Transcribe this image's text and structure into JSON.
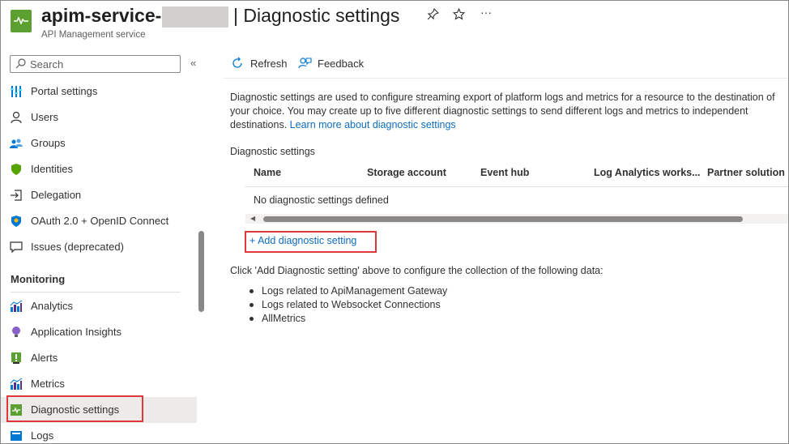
{
  "header": {
    "resource_name": "apim-service-",
    "page_title": "| Diagnostic settings",
    "subtitle": "API Management service",
    "pin_icon": "pin-icon",
    "star_icon": "star-icon",
    "more_label": "···"
  },
  "sidebar": {
    "search_placeholder": "Search",
    "collapse_label": "«",
    "items": [
      {
        "label": "Portal settings",
        "icon": "portal-settings-icon"
      },
      {
        "label": "Users",
        "icon": "user-icon"
      },
      {
        "label": "Groups",
        "icon": "groups-icon"
      },
      {
        "label": "Identities",
        "icon": "shield-icon"
      },
      {
        "label": "Delegation",
        "icon": "delegation-icon"
      },
      {
        "label": "OAuth 2.0 + OpenID Connect",
        "icon": "oauth-shield-icon"
      },
      {
        "label": "Issues (deprecated)",
        "icon": "chat-icon"
      }
    ],
    "monitoring_heading": "Monitoring",
    "monitoring_items": [
      {
        "label": "Analytics",
        "icon": "analytics-icon"
      },
      {
        "label": "Application Insights",
        "icon": "lightbulb-icon"
      },
      {
        "label": "Alerts",
        "icon": "alert-icon"
      },
      {
        "label": "Metrics",
        "icon": "metrics-icon"
      },
      {
        "label": "Diagnostic settings",
        "icon": "diagnostic-icon",
        "selected": true
      },
      {
        "label": "Logs",
        "icon": "logs-icon"
      }
    ]
  },
  "toolbar": {
    "refresh_label": "Refresh",
    "feedback_label": "Feedback"
  },
  "main": {
    "description_line1": "Diagnostic settings are used to configure streaming export of platform logs and metrics for a resource to the destination of",
    "description_line2": "your choice. You may create up to five different diagnostic settings to send different logs and metrics to independent",
    "description_line3_text": "destinations.",
    "learn_more_link": "Learn more about diagnostic settings",
    "settings_label": "Diagnostic settings",
    "columns": [
      "Name",
      "Storage account",
      "Event hub",
      "Log Analytics works...",
      "Partner solution"
    ],
    "empty_message": "No diagnostic settings defined",
    "add_button": "+ Add diagnostic setting",
    "instructions": "Click 'Add Diagnostic setting' above to configure the collection of the following data:",
    "data_items": [
      "Logs related to ApiManagement Gateway",
      "Logs related to Websocket Connections",
      "AllMetrics"
    ]
  },
  "colors": {
    "accent_link": "#0f6cbd",
    "highlight_border": "#e0373b",
    "selected_bg": "#edebe9"
  }
}
